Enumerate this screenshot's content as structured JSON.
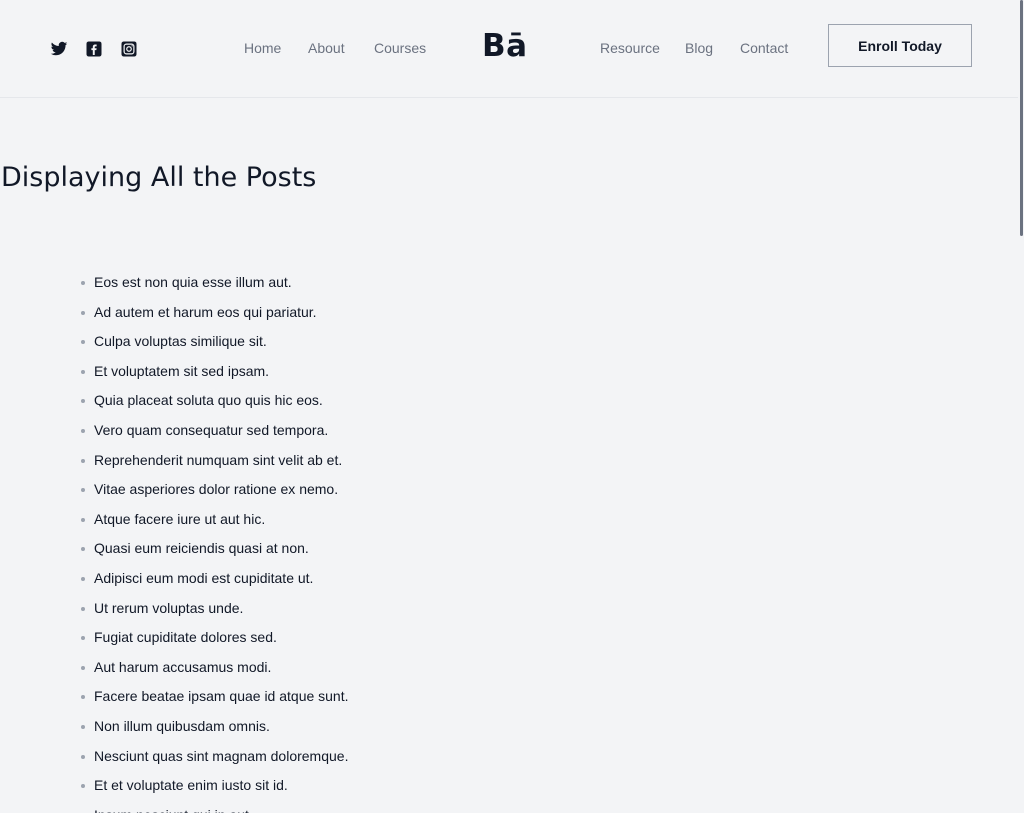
{
  "header": {
    "social_icons": [
      "twitter-icon",
      "facebook-icon",
      "instagram-icon"
    ],
    "nav_left": [
      "Home",
      "About",
      "Courses"
    ],
    "logo": "Bā",
    "nav_right": [
      "Resource",
      "Blog",
      "Contact"
    ],
    "cta_label": "Enroll Today"
  },
  "main": {
    "title": "Displaying All the Posts",
    "posts": [
      "Eos est non quia esse illum aut.",
      "Ad autem et harum eos qui pariatur.",
      "Culpa voluptas similique sit.",
      "Et voluptatem sit sed ipsam.",
      "Quia placeat soluta quo quis hic eos.",
      "Vero quam consequatur sed tempora.",
      "Reprehenderit numquam sint velit ab et.",
      "Vitae asperiores dolor ratione ex nemo.",
      "Atque facere iure ut aut hic.",
      "Quasi eum reiciendis quasi at non.",
      "Adipisci eum modi est cupiditate ut.",
      "Ut rerum voluptas unde.",
      "Fugiat cupiditate dolores sed.",
      "Aut harum accusamus modi.",
      "Facere beatae ipsam quae id atque sunt.",
      "Non illum quibusdam omnis.",
      "Nesciunt quas sint magnam doloremque.",
      "Et et voluptate enim iusto sit id.",
      "Ipsum nesciunt qui in aut."
    ]
  },
  "colors": {
    "background": "#f3f4f6",
    "text": "#111827",
    "muted": "#6b7280",
    "border": "#9ca3af"
  }
}
